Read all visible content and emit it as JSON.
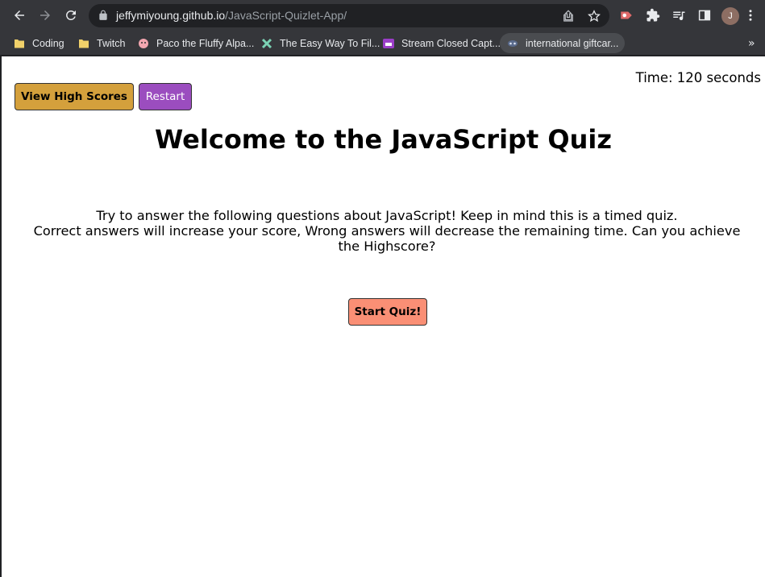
{
  "browser": {
    "url_host": "jeffymiyoung.github.io",
    "url_path": "/JavaScript-Quizlet-App/",
    "profile_initial": "J",
    "bookmarks": [
      {
        "label": "Coding",
        "icon": "folder-icon"
      },
      {
        "label": "Twitch",
        "icon": "folder-icon"
      },
      {
        "label": "Paco the Fluffy Alpa...",
        "icon": "alpaca-favicon"
      },
      {
        "label": "The Easy Way To Fil...",
        "icon": "sparkle-favicon"
      },
      {
        "label": "Stream Closed Capt...",
        "icon": "stream-cc-favicon"
      },
      {
        "label": "international giftcar...",
        "icon": "mask-favicon"
      }
    ],
    "overflow": "»"
  },
  "page": {
    "timer": "Time: 120 seconds",
    "view_high_scores": "View High Scores",
    "restart": "Restart",
    "title": "Welcome to the JavaScript Quiz",
    "intro_line1": "Try to answer the following questions about JavaScript! Keep in mind this is a timed quiz.",
    "intro_line2": "Correct answers will increase your score, Wrong answers will decrease the remaining time. Can you achieve the Highscore?",
    "start_quiz": "Start Quiz!"
  },
  "colors": {
    "chrome_bg": "#35363a",
    "omnibox_bg": "#202124",
    "high_scores_button": "#d4a03c",
    "restart_button": "#9b4dbf",
    "start_button": "#fa8f75"
  }
}
